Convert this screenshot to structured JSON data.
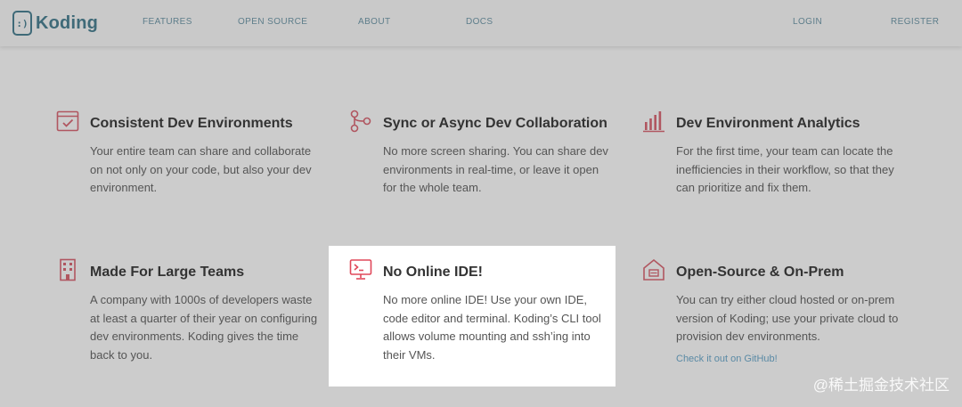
{
  "brand": {
    "name": "Koding",
    "mark": ":)"
  },
  "nav": {
    "features": "FEATURES",
    "open_source": "OPEN SOURCE",
    "about": "ABOUT",
    "docs": "DOCS",
    "login": "LOGIN",
    "register": "REGISTER"
  },
  "features": [
    {
      "title": "Consistent Dev Environments",
      "desc": "Your entire team can share and collaborate on not only on your code, but also your dev environment.",
      "icon": "checklist-window-icon"
    },
    {
      "title": "Sync or Async Dev Collaboration",
      "desc": "No more screen sharing. You can share dev environments in real-time, or leave it open for the whole team.",
      "icon": "branch-nodes-icon"
    },
    {
      "title": "Dev Environment Analytics",
      "desc": "For the first time, your team can locate the inefficiencies in their workflow, so that they can prioritize and fix them.",
      "icon": "bar-chart-icon"
    },
    {
      "title": "Made For Large Teams",
      "desc": "A company with 1000s of developers waste at least a quarter of their year on configuring dev environments. Koding gives the time back to you.",
      "icon": "office-building-icon"
    },
    {
      "title": "No Online IDE!",
      "desc": "No more online IDE! Use your own IDE, code editor and terminal. Koding’s CLI tool allows volume mounting and ssh’ing into their VMs.",
      "icon": "terminal-monitor-icon"
    },
    {
      "title": "Open-Source & On-Prem",
      "desc": "You can try either cloud hosted or on-prem version of Koding; use your private cloud to provision dev environments.",
      "link": "Check it out on GitHub!",
      "icon": "house-server-icon"
    }
  ],
  "watermark": "@稀土掘金技术社区",
  "colors": {
    "accent": "#e0485a",
    "accent_dim": "#b05660",
    "brand": "#3f6a78",
    "overlay": "#cccccc",
    "link": "#5a8aa5"
  }
}
